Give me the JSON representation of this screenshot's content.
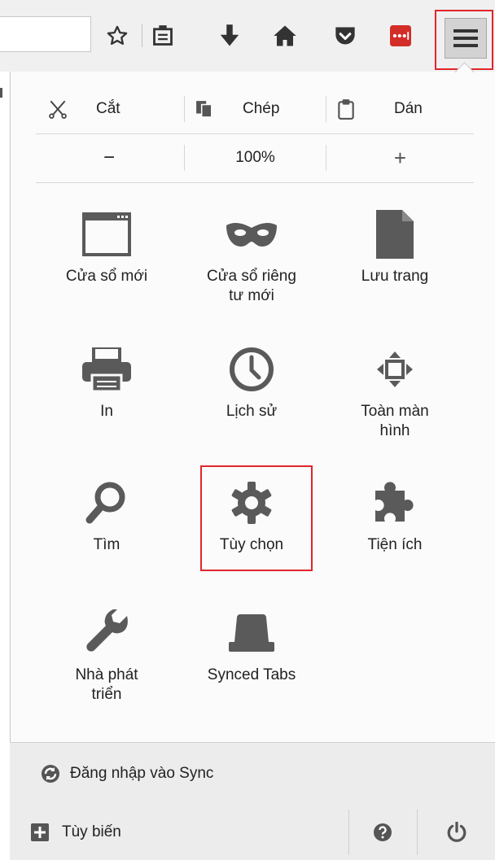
{
  "toolbar": {
    "icons": [
      "star-icon",
      "reading-list-icon",
      "download-icon",
      "home-icon",
      "pocket-icon",
      "lastpass-icon",
      "menu-icon"
    ]
  },
  "menu": {
    "edit": {
      "cut": "Cắt",
      "copy": "Chép",
      "paste": "Dán"
    },
    "zoom": {
      "minus": "−",
      "level": "100%",
      "plus": "+"
    },
    "items": [
      {
        "label": "Cửa sổ mới",
        "icon": "new-window-icon"
      },
      {
        "label": "Cửa sổ riêng\ntư mới",
        "icon": "private-mask-icon"
      },
      {
        "label": "Lưu trang",
        "icon": "save-page-icon"
      },
      {
        "label": "In",
        "icon": "print-icon"
      },
      {
        "label": "Lịch sử",
        "icon": "history-clock-icon"
      },
      {
        "label": "Toàn màn\nhình",
        "icon": "fullscreen-icon"
      },
      {
        "label": "Tìm",
        "icon": "find-icon"
      },
      {
        "label": "Tùy chọn",
        "icon": "options-gear-icon"
      },
      {
        "label": "Tiện ích",
        "icon": "addons-puzzle-icon"
      },
      {
        "label": "Nhà phát\ntriển",
        "icon": "developer-wrench-icon"
      },
      {
        "label": "Synced Tabs",
        "icon": "synced-tabs-icon"
      }
    ],
    "sync_label": "Đăng nhập vào Sync",
    "customize_label": "Tùy biến"
  },
  "colors": {
    "highlight": "#e0262b",
    "icon": "#5a5a5a",
    "panel": "#fbfbfb",
    "footer": "#ececec"
  }
}
